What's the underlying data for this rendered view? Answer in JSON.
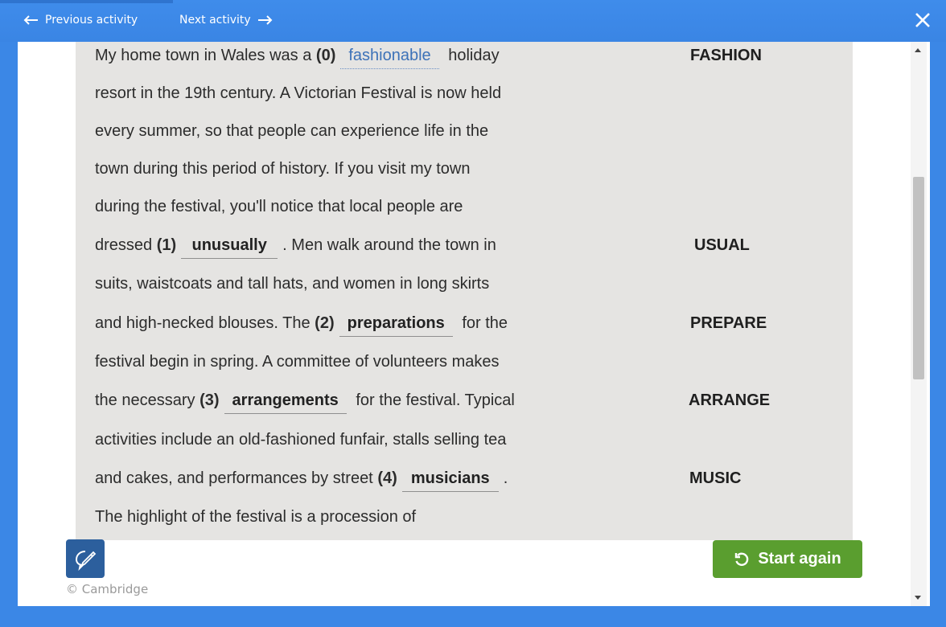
{
  "header": {
    "previous_label": "Previous activity",
    "next_label": "Next activity"
  },
  "text": {
    "line1a": "My home town in Wales was a ",
    "line1_num": "(0)",
    "line1_answer": "fashionable",
    "line1b": " holiday",
    "line2": "resort in the 19th century. A Victorian Festival is now held",
    "line3": "every summer, so that people can experience life in the",
    "line4": "town during this period of history. If you visit my town",
    "line5": "during the festival, you'll notice that local people are",
    "line6a": "dressed ",
    "line6_num": "(1)",
    "line6_answer": "unusually",
    "line6b": ". Men walk around the town in",
    "line7": "suits, waistcoats and tall hats, and women in long skirts",
    "line8a": "and high-necked blouses. The ",
    "line8_num": "(2)",
    "line8_answer": "preparations",
    "line8b": " for the",
    "line9": "festival begin in spring. A committee of volunteers makes",
    "line10a": "the necessary ",
    "line10_num": "(3)",
    "line10_answer": "arrangements",
    "line10b": " for the festival. Typical",
    "line11": "activities include an old-fashioned funfair, stalls selling tea",
    "line12a": "and cakes, and performances by street ",
    "line12_num": "(4)",
    "line12_answer": "musicians",
    "line12b": ".",
    "line13": "The highlight of the festival is a procession of"
  },
  "keywords": {
    "k0": "FASHION",
    "k1": "USUAL",
    "k2": "PREPARE",
    "k3": "ARRANGE",
    "k4": "MUSIC"
  },
  "footer": {
    "copyright": "© Cambridge",
    "start_again": "Start again"
  },
  "colors": {
    "header_blue": "#3b87e6",
    "panel_grey": "#e5e4e2",
    "start_green": "#5a9e2f",
    "tool_blue": "#2c5f9d",
    "example_blue": "#3d72b8"
  }
}
